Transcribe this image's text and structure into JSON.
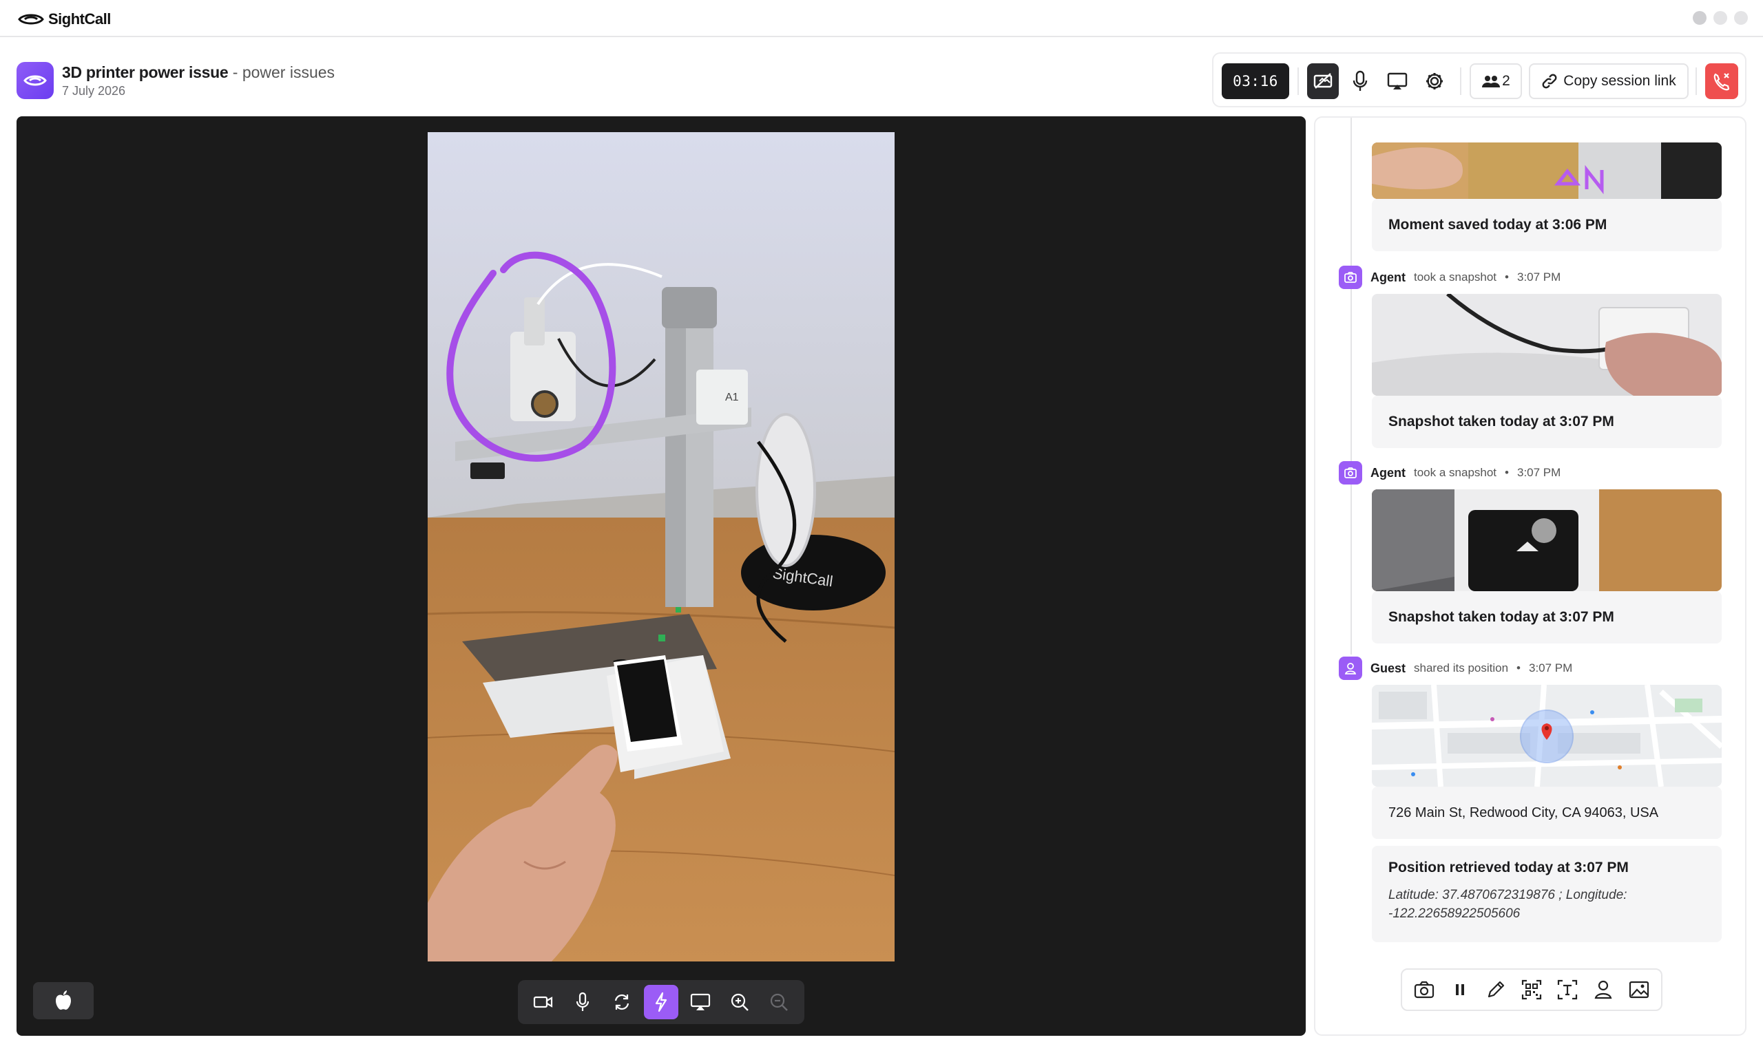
{
  "app": {
    "brand": "SightCall"
  },
  "session": {
    "title": "3D printer power issue",
    "separator": " - ",
    "category": "power issues",
    "date": "7 July 2026"
  },
  "toolbar": {
    "timer": "03:16",
    "participants_count": "2",
    "copy_link_label": "Copy session link",
    "icons": [
      "video-off-icon",
      "microphone-icon",
      "screen-share-icon",
      "gear-icon",
      "participants-icon",
      "link-icon",
      "hang-up-icon"
    ]
  },
  "video": {
    "device_os_icon": "apple-icon",
    "controls": [
      "camera-icon",
      "microphone-icon",
      "switch-camera-icon",
      "flash-icon",
      "screen-cast-icon",
      "zoom-in-icon",
      "zoom-out-icon"
    ],
    "active_control": "flash-icon",
    "annotation_color": "#a64ee8"
  },
  "feed": {
    "items": [
      {
        "type": "moment",
        "caption": "Moment saved today at 3:06 PM"
      },
      {
        "type": "snapshot",
        "actor": "Agent",
        "action": "took a snapshot",
        "separator": "•",
        "time": "3:07 PM",
        "caption": "Snapshot taken today at 3:07 PM"
      },
      {
        "type": "snapshot",
        "actor": "Agent",
        "action": "took a snapshot",
        "separator": "•",
        "time": "3:07 PM",
        "caption": "Snapshot taken today at 3:07 PM"
      },
      {
        "type": "position",
        "actor": "Guest",
        "action": "shared its position",
        "separator": "•",
        "time": "3:07 PM",
        "address": "726 Main St, Redwood City, CA 94063, USA",
        "result_title": "Position retrieved today at 3:07 PM",
        "coordinates": "Latitude: 37.4870672319876 ; Longitude: -122.22658922505606"
      }
    ],
    "tools": [
      "camera-icon",
      "pause-icon",
      "pen-icon",
      "qr-code-icon",
      "ocr-icon",
      "location-user-icon",
      "image-icon"
    ]
  },
  "colors": {
    "accent": "#9b5cf6",
    "danger": "#ef4e4e",
    "dark": "#1b1b1b"
  }
}
